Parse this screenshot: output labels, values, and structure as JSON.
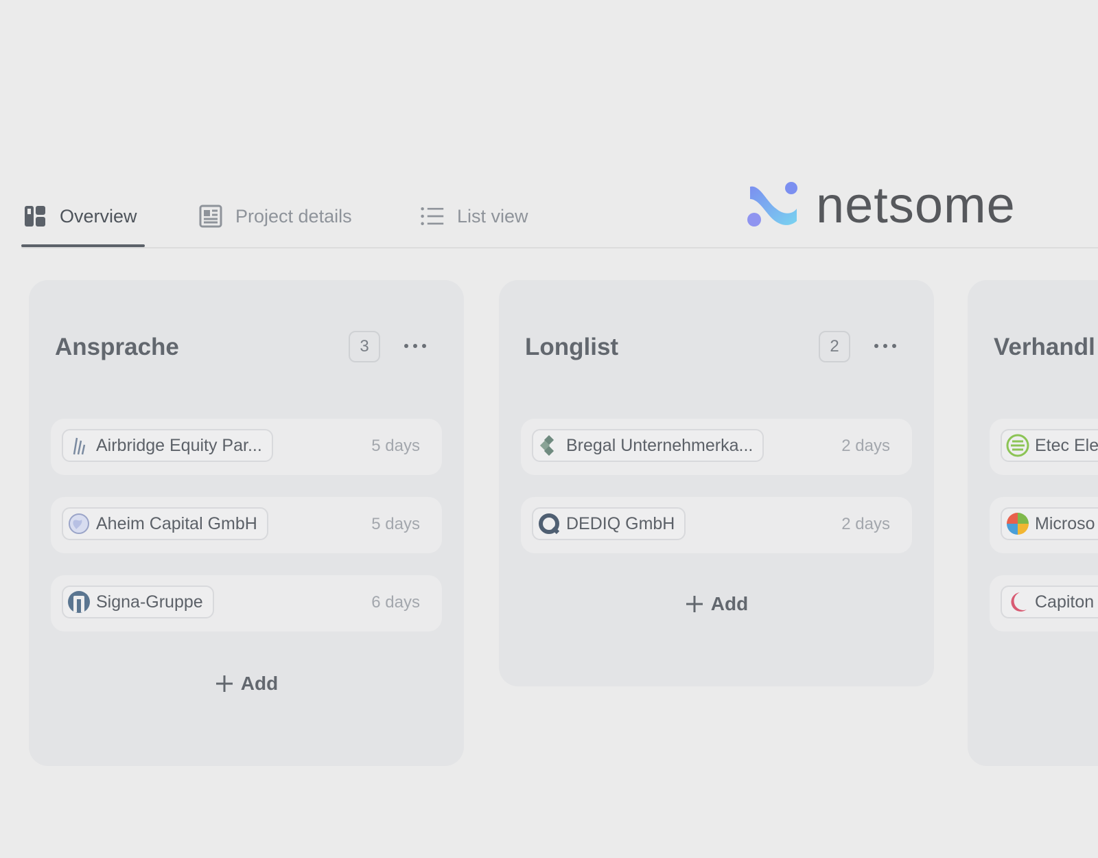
{
  "tabs": [
    {
      "label": "Overview",
      "icon": "dashboard-icon",
      "active": true
    },
    {
      "label": "Project details",
      "icon": "document-icon",
      "active": false
    },
    {
      "label": "List view",
      "icon": "list-icon",
      "active": false
    }
  ],
  "brand": {
    "name": "netsome",
    "colors": {
      "gradient_start": "#7b8ff0",
      "gradient_end": "#79d3f0"
    }
  },
  "columns": [
    {
      "title": "Ansprache",
      "count": "3",
      "cards": [
        {
          "name": "Airbridge Equity Par...",
          "icon": "airbridge-logo-icon",
          "age": "5 days"
        },
        {
          "name": "Aheim Capital GmbH",
          "icon": "globe-logo-icon",
          "age": "5 days"
        },
        {
          "name": "Signa-Gruppe",
          "icon": "signa-logo-icon",
          "age": "6 days"
        }
      ],
      "add_label": "Add"
    },
    {
      "title": "Longlist",
      "count": "2",
      "cards": [
        {
          "name": "Bregal Unternehmerka...",
          "icon": "bregal-logo-icon",
          "age": "2 days"
        },
        {
          "name": "DEDIQ GmbH",
          "icon": "dediq-logo-icon",
          "age": "2 days"
        }
      ],
      "add_label": "Add"
    },
    {
      "title": "Verhandl",
      "cards": [
        {
          "name": "Etec Ele",
          "icon": "etec-logo-icon"
        },
        {
          "name": "Microso",
          "icon": "microsoft-logo-icon"
        },
        {
          "name": "Capiton",
          "icon": "capiton-logo-icon"
        }
      ]
    }
  ]
}
